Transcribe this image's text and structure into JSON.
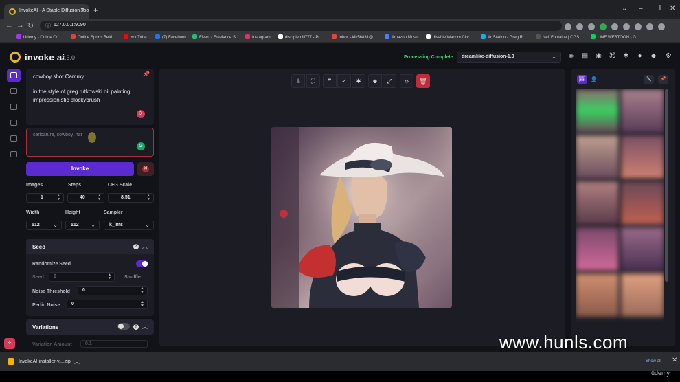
{
  "browser": {
    "tab_title": "InvokeAI - A Stable Diffusion Too",
    "url": "127.0.0.1:9090",
    "bookmarks": [
      {
        "label": "Udemy - Online Co...",
        "color": "#a435f0"
      },
      {
        "label": "Online Sports Betti...",
        "color": "#e04040"
      },
      {
        "label": "YouTube",
        "color": "#ff0000"
      },
      {
        "label": "(7) Facebook",
        "color": "#1877f2"
      },
      {
        "label": "Fiverr - Freelance S...",
        "color": "#1dbf73"
      },
      {
        "label": "Instagram",
        "color": "#e1306c"
      },
      {
        "label": "disciplemill777 - Pr...",
        "color": "#ffffff"
      },
      {
        "label": "Inbox - kik56831@...",
        "color": "#ea4335"
      },
      {
        "label": "Amazon Music",
        "color": "#4a7dff"
      },
      {
        "label": "disable Wacom Circ...",
        "color": "#ffffff"
      },
      {
        "label": "ArtStation - Greg R...",
        "color": "#13aff0"
      },
      {
        "label": "Neil Fontaine | CGS...",
        "color": "#555555"
      },
      {
        "label": "LINE WEBTOON - G...",
        "color": "#00d564"
      }
    ]
  },
  "header": {
    "app_name": "invoke ai",
    "version": "2.3.0",
    "status": "Processing Complete",
    "model": "dreamlike-diffusion-1.0"
  },
  "prompt": {
    "positive_line1": "cowboy shot Cammy",
    "positive_line2": "in the style of greg rutkowski oil painting, impressionistic blockybrush",
    "badge": "3",
    "negative": "caricature, cowboy, hat"
  },
  "buttons": {
    "invoke": "Invoke"
  },
  "params": {
    "images_label": "Images",
    "images": "1",
    "steps_label": "Steps",
    "steps": "40",
    "cfg_label": "CFG Scale",
    "cfg": "8.51",
    "width_label": "Width",
    "width": "512",
    "height_label": "Height",
    "height": "512",
    "sampler_label": "Sampler",
    "sampler": "k_lms"
  },
  "seed": {
    "title": "Seed",
    "randomize_label": "Randomize Seed",
    "randomize_on": true,
    "seed_label": "Seed",
    "seed_value": "0",
    "shuffle_label": "Shuffle",
    "noise_label": "Noise Threshold",
    "noise_value": "0",
    "perlin_label": "Perlin Noise",
    "perlin_value": "0"
  },
  "variations": {
    "title": "Variations",
    "amount_label": "Variation Amount",
    "amount_value": "0.1"
  },
  "download": {
    "file": "InvokeAI-installer-v....zip",
    "show_all": "Show all"
  },
  "watermark": {
    "site": "www.hunls.com",
    "udemy": "ûdemy"
  },
  "colors": {
    "accent": "#5b2bd1",
    "status": "#3ed16b",
    "danger": "#c52a38"
  }
}
